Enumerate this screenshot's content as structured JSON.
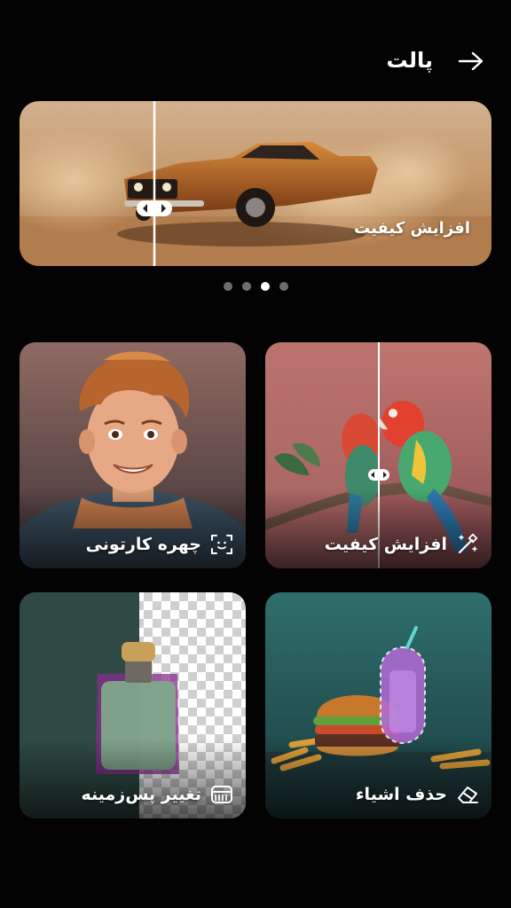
{
  "header": {
    "title": "پالت",
    "back_icon": "arrow-right-icon"
  },
  "hero": {
    "label": "افزایش کیفیت",
    "compare_handle_icon": "compare-handle-icon"
  },
  "carousel": {
    "count": 4,
    "active_index": 2
  },
  "cards": [
    {
      "id": "quality",
      "label": "افزایش کیفیت",
      "icon": "magic-wand-icon"
    },
    {
      "id": "cartoon",
      "label": "چهره کارتونی",
      "icon": "face-scan-icon"
    },
    {
      "id": "remove",
      "label": "حذف اشیاء",
      "icon": "eraser-icon"
    },
    {
      "id": "background",
      "label": "تغییر پس‌زمینه",
      "icon": "background-replace-icon"
    }
  ],
  "colors": {
    "background": "#030303",
    "text": "#ffffff",
    "dot_inactive": "#6e6e6e",
    "dot_active": "#ffffff"
  }
}
